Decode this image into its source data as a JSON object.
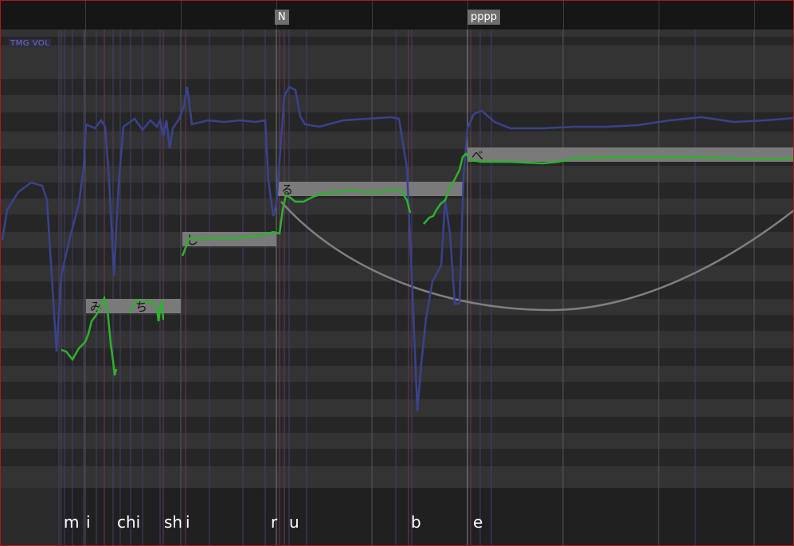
{
  "markers": {
    "note_marker": "N",
    "dynamics_marker": "pppp"
  },
  "param_tabs": {
    "tmg": "TMG",
    "vol": "VOL"
  },
  "notes": [
    {
      "lyric": "み",
      "pitch_row": 12
    },
    {
      "lyric": "ち",
      "pitch_row": 12
    },
    {
      "lyric": "し",
      "pitch_row": 9
    },
    {
      "lyric": "る",
      "pitch_row": 7
    },
    {
      "lyric": "べ",
      "pitch_row": 5
    }
  ],
  "phonemes": [
    {
      "text": "m"
    },
    {
      "text": "i"
    },
    {
      "text": "chi"
    },
    {
      "text": "sh"
    },
    {
      "text": "i"
    },
    {
      "text": "r"
    },
    {
      "text": "u"
    },
    {
      "text": "b"
    },
    {
      "text": "e"
    }
  ],
  "colors": {
    "pitch_curve": "#2fb12f",
    "volume_curve": "#3a428c",
    "vibrato_arc": "#808080",
    "note_fill": "#7a7a7a",
    "border": "#b01818"
  }
}
